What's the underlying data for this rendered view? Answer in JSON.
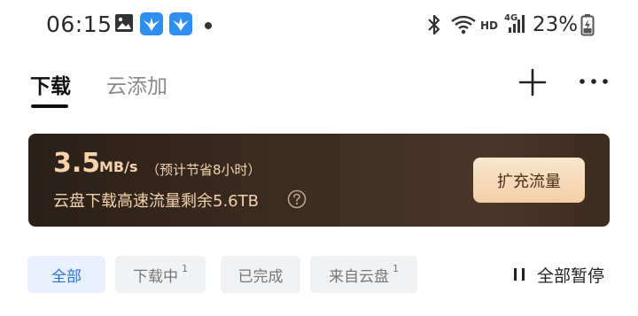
{
  "status_bar": {
    "time": "06:15",
    "hd": "HD",
    "network": "4G",
    "battery": "23%"
  },
  "header": {
    "tabs": [
      {
        "label": "下载",
        "active": true
      },
      {
        "label": "云添加",
        "active": false
      }
    ]
  },
  "banner": {
    "speed_value": "3.5",
    "speed_unit": "MB/s",
    "speed_note": "（预计节省8小时）",
    "quota_text": "云盘下载高速流量剩余5.6TB",
    "button_label": "扩充流量"
  },
  "filters": [
    {
      "label": "全部",
      "badge": "",
      "active": true
    },
    {
      "label": "下载中",
      "badge": "1",
      "active": false
    },
    {
      "label": "已完成",
      "badge": "",
      "active": false
    },
    {
      "label": "来自云盘",
      "badge": "1",
      "active": false
    }
  ],
  "pause_all_label": "全部暂停",
  "icons": {
    "image": "image-icon",
    "app": "bird-app-icon",
    "bluetooth": "bluetooth-icon",
    "wifi": "wifi-icon",
    "signal": "signal-icon",
    "battery": "battery-icon",
    "add": "plus-icon",
    "more": "more-icon",
    "help": "help-icon",
    "pause": "pause-icon"
  },
  "colors": {
    "accent": "#2f6fd6",
    "banner_text": "#f3d2ac",
    "banner_button": "#f2cfa6"
  }
}
